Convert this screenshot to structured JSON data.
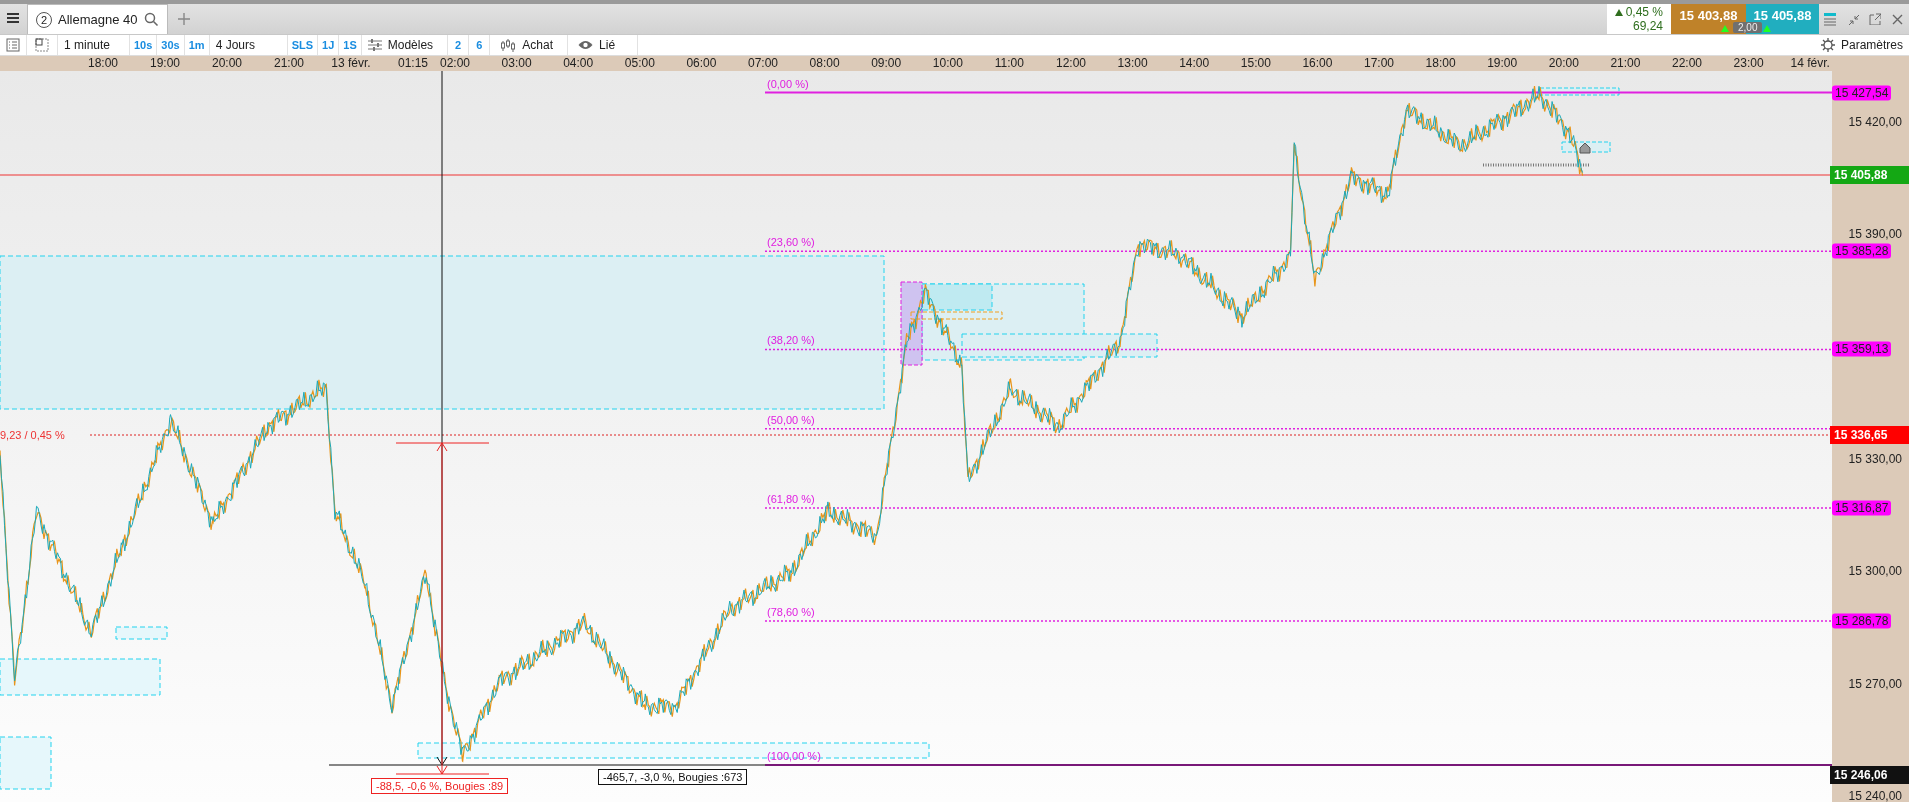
{
  "tab_bar": {
    "tabs": [
      {
        "number": "2",
        "label": "Allemagne 40",
        "selected": true
      }
    ],
    "quote": {
      "change": "0,45 %",
      "change_points": "69,24",
      "bid": "15 403,88",
      "ask": "15 405,88",
      "spread": "2,00"
    }
  },
  "toolbar": {
    "interval": "1 minute",
    "interval_shortcuts": [
      "10s",
      "30s",
      "1m"
    ],
    "period": "4 Jours",
    "period_shortcuts": [
      "SLS",
      "1J",
      "1S"
    ],
    "templates": "Modèles",
    "layouts": [
      "2",
      "6"
    ],
    "order": "Achat",
    "link": "Lié",
    "settings": "Paramètres"
  },
  "chart": {
    "time_axis": [
      "18:00",
      "19:00",
      "20:00",
      "21:00",
      "13 févr.",
      "01:15",
      "02:00",
      "03:00",
      "04:00",
      "05:00",
      "06:00",
      "07:00",
      "08:00",
      "09:00",
      "10:00",
      "11:00",
      "12:00",
      "13:00",
      "14:00",
      "15:00",
      "16:00",
      "17:00",
      "18:00",
      "19:00",
      "20:00",
      "21:00",
      "22:00",
      "23:00",
      "14 févr."
    ],
    "price_axis": [
      "15 420,00",
      "15 390,00",
      "15 330,00",
      "15 300,00",
      "15 270,00",
      "15 240,00"
    ],
    "fibonacci": [
      {
        "label": "(0,00 %)",
        "tag": "15 427,54"
      },
      {
        "label": "(23,60 %)",
        "tag": "15 385,28"
      },
      {
        "label": "(38,20 %)",
        "tag": "15 359,13"
      },
      {
        "label": "(50,00 %)"
      },
      {
        "label": "(61,80 %)",
        "tag": "15 316,87"
      },
      {
        "label": "(78,60 %)",
        "tag": "15 286,78"
      },
      {
        "label": "(100,00 %)"
      }
    ],
    "last_price": "15 405,88",
    "reference_line": {
      "label": "9,23 / 0,45 %",
      "tag": "15 336,65"
    },
    "low_line_tag": "15 246,06",
    "measures": [
      {
        "kind": "bracket",
        "label": "-88,5, -0,6 %, Bougies :89"
      },
      {
        "kind": "line",
        "label": "-465,7, -3,0 %, Bougies :673"
      }
    ]
  }
}
